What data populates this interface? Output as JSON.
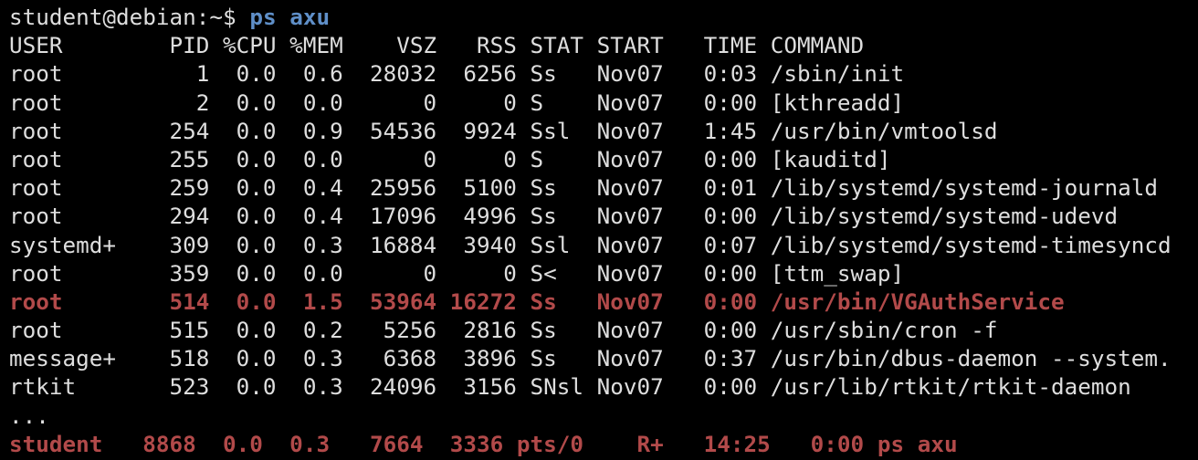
{
  "terminal": {
    "prompt": "student@debian:~$",
    "command": "ps axu",
    "header": [
      "USER",
      "PID",
      "%CPU",
      "%MEM",
      "VSZ",
      "RSS",
      "STAT",
      "START",
      "TIME",
      "COMMAND"
    ],
    "rows": [
      {
        "user": "root",
        "pid": "1",
        "cpu": "0.0",
        "mem": "0.6",
        "vsz": "28032",
        "rss": "6256",
        "stat": "Ss",
        "start": "Nov07",
        "time": "0:03",
        "command": "/sbin/init",
        "highlight": false
      },
      {
        "user": "root",
        "pid": "2",
        "cpu": "0.0",
        "mem": "0.0",
        "vsz": "0",
        "rss": "0",
        "stat": "S",
        "start": "Nov07",
        "time": "0:00",
        "command": "[kthreadd]",
        "highlight": false
      },
      {
        "user": "root",
        "pid": "254",
        "cpu": "0.0",
        "mem": "0.9",
        "vsz": "54536",
        "rss": "9924",
        "stat": "Ssl",
        "start": "Nov07",
        "time": "1:45",
        "command": "/usr/bin/vmtoolsd",
        "highlight": false
      },
      {
        "user": "root",
        "pid": "255",
        "cpu": "0.0",
        "mem": "0.0",
        "vsz": "0",
        "rss": "0",
        "stat": "S",
        "start": "Nov07",
        "time": "0:00",
        "command": "[kauditd]",
        "highlight": false
      },
      {
        "user": "root",
        "pid": "259",
        "cpu": "0.0",
        "mem": "0.4",
        "vsz": "25956",
        "rss": "5100",
        "stat": "Ss",
        "start": "Nov07",
        "time": "0:01",
        "command": "/lib/systemd/systemd-journald",
        "highlight": false
      },
      {
        "user": "root",
        "pid": "294",
        "cpu": "0.0",
        "mem": "0.4",
        "vsz": "17096",
        "rss": "4996",
        "stat": "Ss",
        "start": "Nov07",
        "time": "0:00",
        "command": "/lib/systemd/systemd-udevd",
        "highlight": false
      },
      {
        "user": "systemd+",
        "pid": "309",
        "cpu": "0.0",
        "mem": "0.3",
        "vsz": "16884",
        "rss": "3940",
        "stat": "Ssl",
        "start": "Nov07",
        "time": "0:07",
        "command": "/lib/systemd/systemd-timesyncd",
        "highlight": false
      },
      {
        "user": "root",
        "pid": "359",
        "cpu": "0.0",
        "mem": "0.0",
        "vsz": "0",
        "rss": "0",
        "stat": "S<",
        "start": "Nov07",
        "time": "0:00",
        "command": "[ttm_swap]",
        "highlight": false
      },
      {
        "user": "root",
        "pid": "514",
        "cpu": "0.0",
        "mem": "1.5",
        "vsz": "53964",
        "rss": "16272",
        "stat": "Ss",
        "start": "Nov07",
        "time": "0:00",
        "command": "/usr/bin/VGAuthService",
        "highlight": true
      },
      {
        "user": "root",
        "pid": "515",
        "cpu": "0.0",
        "mem": "0.2",
        "vsz": "5256",
        "rss": "2816",
        "stat": "Ss",
        "start": "Nov07",
        "time": "0:00",
        "command": "/usr/sbin/cron -f",
        "highlight": false
      },
      {
        "user": "message+",
        "pid": "518",
        "cpu": "0.0",
        "mem": "0.3",
        "vsz": "6368",
        "rss": "3896",
        "stat": "Ss",
        "start": "Nov07",
        "time": "0:37",
        "command": "/usr/bin/dbus-daemon --system.",
        "highlight": false
      },
      {
        "user": "rtkit",
        "pid": "523",
        "cpu": "0.0",
        "mem": "0.3",
        "vsz": "24096",
        "rss": "3156",
        "stat": "SNsl",
        "start": "Nov07",
        "time": "0:00",
        "command": "/usr/lib/rtkit/rtkit-daemon",
        "highlight": false
      }
    ],
    "ellipsis": "...",
    "last_row": {
      "user": "student",
      "pid": "8868",
      "cpu": "0.0",
      "mem": "0.3",
      "vsz": "7664",
      "rss": "3336",
      "stat": "pts/0",
      "start": "R+",
      "time": "14:25",
      "command": "0:00 ps axu",
      "highlight": true
    }
  },
  "colors": {
    "background": "#000000",
    "text": "#dedede",
    "command": "#5f8fc8",
    "highlight": "#b24a4a"
  }
}
